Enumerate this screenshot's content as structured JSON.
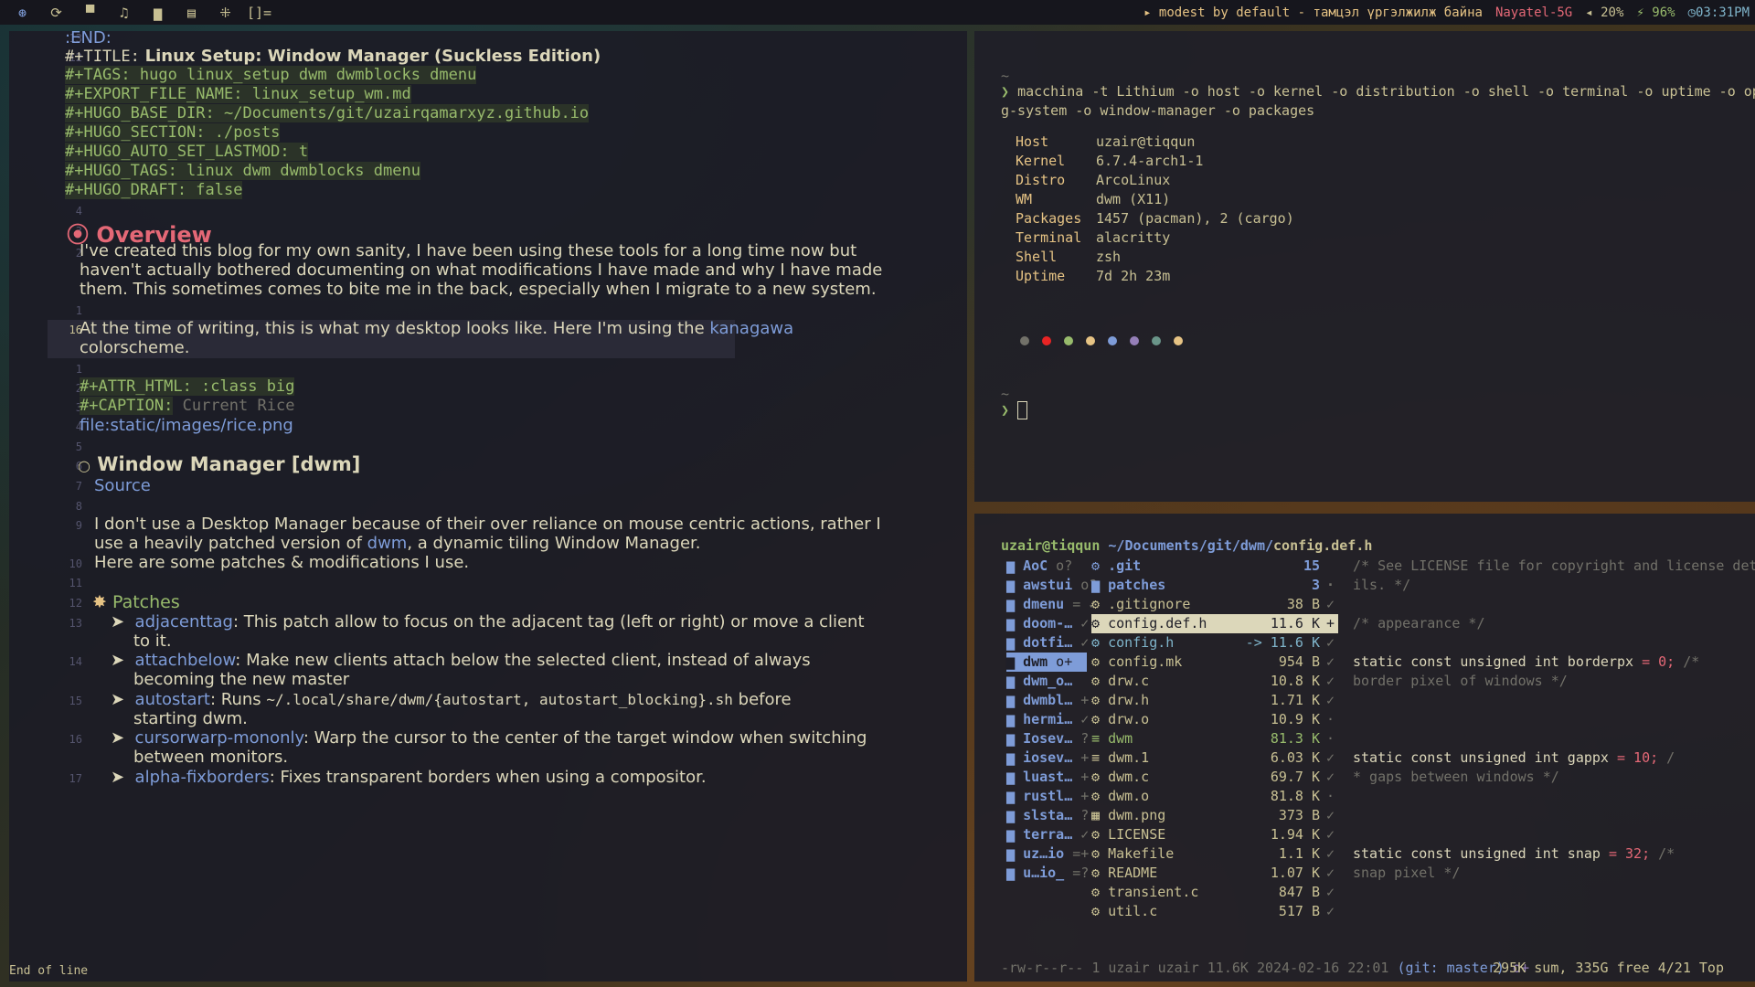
{
  "bar": {
    "tags": [
      "⊛",
      "⟳",
      "▀",
      "♫",
      "▆",
      "▤",
      "⁜",
      "[]="
    ],
    "title": "▸ modest by default - тамцэл үргэлжилж байна",
    "wifi": "Nayatel-5G",
    "volume": "◂ 20%",
    "battery": "⚡ 96%",
    "clock": "◷03:31PM"
  },
  "editor": {
    "lines": [
      {
        "n": "13",
        "t": ":END:"
      },
      {
        "n": "12",
        "t": "#+TITLE:",
        "t2": "Linux Setup: Window Manager (Suckless Edition)"
      },
      {
        "n": "11",
        "t": "#+TAGS: hugo linux_setup dwm dwmblocks dmenu"
      },
      {
        "n": "10",
        "t": "#+EXPORT_FILE_NAME: linux_setup_wm.md"
      },
      {
        "n": "9",
        "t": "#+HUGO_BASE_DIR: ~/Documents/git/uzairqamarxyz.github.io"
      },
      {
        "n": "8",
        "t": "#+HUGO_SECTION: ./posts"
      },
      {
        "n": "7",
        "t": "#+HUGO_AUTO_SET_LASTMOD: t"
      },
      {
        "n": "6",
        "t": "#+HUGO_TAGS: linux dwm dwmblocks dmenu"
      },
      {
        "n": "5",
        "t": "#+HUGO_DRAFT: false"
      },
      {
        "n": "4",
        "t": ""
      },
      {
        "n": "3",
        "t": "Overview"
      },
      {
        "n": "2",
        "t": "I've created this blog for my own sanity, I have been using these tools for a long time now but"
      },
      {
        "n": "",
        "t": "haven't actually bothered documenting on what modifications I have made and why I have made"
      },
      {
        "n": "",
        "t": "them. This sometimes comes to bite me in the back, especially when I migrate to a new system."
      },
      {
        "n": "1",
        "t": ""
      },
      {
        "n": "16",
        "t": "At the time of writing, this is what my desktop looks like. Here I'm using the",
        "t2": "kanagawa"
      },
      {
        "n": "",
        "t": "colorscheme."
      },
      {
        "n": "1",
        "t": ""
      },
      {
        "n": "2",
        "t": "#+ATTR_HTML: :class big"
      },
      {
        "n": "3",
        "t": "#+CAPTION:",
        "t2": "Current Rice"
      },
      {
        "n": "4",
        "t": "file:static/images/rice.png"
      },
      {
        "n": "5",
        "t": ""
      },
      {
        "n": "6",
        "t": "Window Manager [dwm]"
      },
      {
        "n": "7",
        "t": "Source"
      },
      {
        "n": "8",
        "t": ""
      },
      {
        "n": "9",
        "t": "I don't use a Desktop Manager because of their over reliance on mouse centric actions, rather I"
      },
      {
        "n": "",
        "t": "use a heavily patched version of",
        "t2": "dwm",
        ",t3": ""
      },
      {
        "n": "10",
        "t": "Here are some patches & modifications I use."
      },
      {
        "n": "11",
        "t": ""
      },
      {
        "n": "12",
        "t": "Patches"
      }
    ],
    "dwm_suffix": ", a dynamic tiling Window Manager.",
    "patches": [
      {
        "n": "13",
        "name": "adjacenttag",
        "desc": ": This patch allow to focus on the adjacent tag (left or right) or move a client",
        "desc2": "to it."
      },
      {
        "n": "14",
        "name": "attachbelow",
        "desc": ": Make new clients attach below the selected client, instead of always",
        "desc2": "becoming the new master"
      },
      {
        "n": "15",
        "name": "autostart",
        "desc": ": Runs ",
        "code": "~/.local/share/dwm/{autostart, autostart_blocking}.sh",
        "desc3": " before",
        "desc2": "starting dwm."
      },
      {
        "n": "16",
        "name": "cursorwarp-mononly",
        "desc": ": Warp the cursor to the center of the target window when switching",
        "desc2": "between monitors."
      },
      {
        "n": "17",
        "name": "alpha-fixborders",
        "desc": ": Fixes transparent borders when using a compositor.",
        "desc2": ""
      }
    ],
    "status": "End of line"
  },
  "term1": {
    "tilde": "~",
    "prompt": "❯",
    "cmd": "macchina -t Lithium -o host -o kernel -o distribution -o shell -o terminal -o uptime -o operatin",
    "cmd2": "g-system -o window-manager -o packages",
    "info": [
      {
        "k": "Host",
        "v": "uzair@tiqqun"
      },
      {
        "k": "Kernel",
        "v": "6.7.4-arch1-1"
      },
      {
        "k": "Distro",
        "v": "ArcoLinux"
      },
      {
        "k": "WM",
        "v": "dwm (X11)"
      },
      {
        "k": "Packages",
        "v": "1457 (pacman), 2 (cargo)"
      },
      {
        "k": "Terminal",
        "v": "alacritty"
      },
      {
        "k": "Shell",
        "v": "zsh"
      },
      {
        "k": "Uptime",
        "v": "7d 2h 23m"
      }
    ],
    "dots": [
      "#727169",
      "#e82424",
      "#98bb6c",
      "#e6c384",
      "#7e9cd8",
      "#957fb8",
      "#6a9589",
      "#e6c384"
    ]
  },
  "term2": {
    "header_user": "uzair@tiqqun",
    "header_path": "~/Documents/git/dwm/",
    "header_file": "config.def.h",
    "parents": [
      {
        "name": "AoC",
        "flag": "o?"
      },
      {
        "name": "awstui",
        "flag": "o?"
      },
      {
        "name": "dmenu",
        "flag": "= ✓"
      },
      {
        "name": "doom-…",
        "flag": "✓"
      },
      {
        "name": "dotfi…",
        "flag": "✓"
      },
      {
        "name": "dwm",
        "flag": "o+"
      },
      {
        "name": "dwm_o…",
        "flag": ""
      },
      {
        "name": "dwmbl…",
        "flag": "+"
      },
      {
        "name": "hermi…",
        "flag": "✓"
      },
      {
        "name": "Iosev…",
        "flag": "?"
      },
      {
        "name": "iosev…",
        "flag": "+"
      },
      {
        "name": "luast…",
        "flag": "+"
      },
      {
        "name": "rustl…",
        "flag": "+"
      },
      {
        "name": "slsta…",
        "flag": "?"
      },
      {
        "name": "terra…",
        "flag": "✓"
      },
      {
        "name": "uz…io",
        "flag": "=+"
      },
      {
        "name": "u…io_",
        "flag": "=?"
      }
    ],
    "files": [
      {
        "icon": "⚙",
        "name": ".git",
        "size": "15",
        "flag": ""
      },
      {
        "icon": "▆",
        "name": "patches",
        "size": "3",
        "flag": "·"
      },
      {
        "icon": "⚙",
        "name": ".gitignore",
        "size": "38 B",
        "flag": "✓"
      },
      {
        "icon": "⚙",
        "name": "config.def.h",
        "size": "11.6 K",
        "flag": "+"
      },
      {
        "icon": "⚙",
        "name": "config.h",
        "size": "-> 11.6 K",
        "flag": "✓"
      },
      {
        "icon": "⚙",
        "name": "config.mk",
        "size": "954 B",
        "flag": "✓"
      },
      {
        "icon": "⚙",
        "name": "drw.c",
        "size": "10.8 K",
        "flag": "✓"
      },
      {
        "icon": "⚙",
        "name": "drw.h",
        "size": "1.71 K",
        "flag": "✓"
      },
      {
        "icon": "⚙",
        "name": "drw.o",
        "size": "10.9 K",
        "flag": "·"
      },
      {
        "icon": "≡",
        "name": "dwm",
        "size": "81.3 K",
        "flag": "·"
      },
      {
        "icon": "≡",
        "name": "dwm.1",
        "size": "6.03 K",
        "flag": "✓"
      },
      {
        "icon": "⚙",
        "name": "dwm.c",
        "size": "69.7 K",
        "flag": "✓"
      },
      {
        "icon": "⚙",
        "name": "dwm.o",
        "size": "81.8 K",
        "flag": "·"
      },
      {
        "icon": "▦",
        "name": "dwm.png",
        "size": "373 B",
        "flag": "✓"
      },
      {
        "icon": "⚙",
        "name": "LICENSE",
        "size": "1.94 K",
        "flag": "✓"
      },
      {
        "icon": "⚙",
        "name": "Makefile",
        "size": "1.1 K",
        "flag": "✓"
      },
      {
        "icon": "⚙",
        "name": "README",
        "size": "1.07 K",
        "flag": "✓"
      },
      {
        "icon": "⚙",
        "name": "transient.c",
        "size": "847 B",
        "flag": "✓"
      },
      {
        "icon": "⚙",
        "name": "util.c",
        "size": "517 B",
        "flag": "✓"
      }
    ],
    "preview": [
      "/* See LICENSE file for copyright and license deta",
      "ils. */",
      "",
      "/* appearance */",
      "",
      "static const unsigned int borderpx  = 0;        /*",
      " border pixel of windows */",
      "",
      "",
      "",
      "static const unsigned int gappx     = 10;       /",
      "* gaps between windows */",
      "",
      "",
      "",
      "static const unsigned int snap      = 32;       /*",
      " snap pixel */"
    ],
    "footer_left": "-rw-r--r-- 1 uzair uzair 11.6K 2024-02-16 22:01",
    "footer_git": "(git: master)",
    "footer_git_flag": "o+",
    "footer_right": "295K sum, 335G free  4/21  Top"
  }
}
